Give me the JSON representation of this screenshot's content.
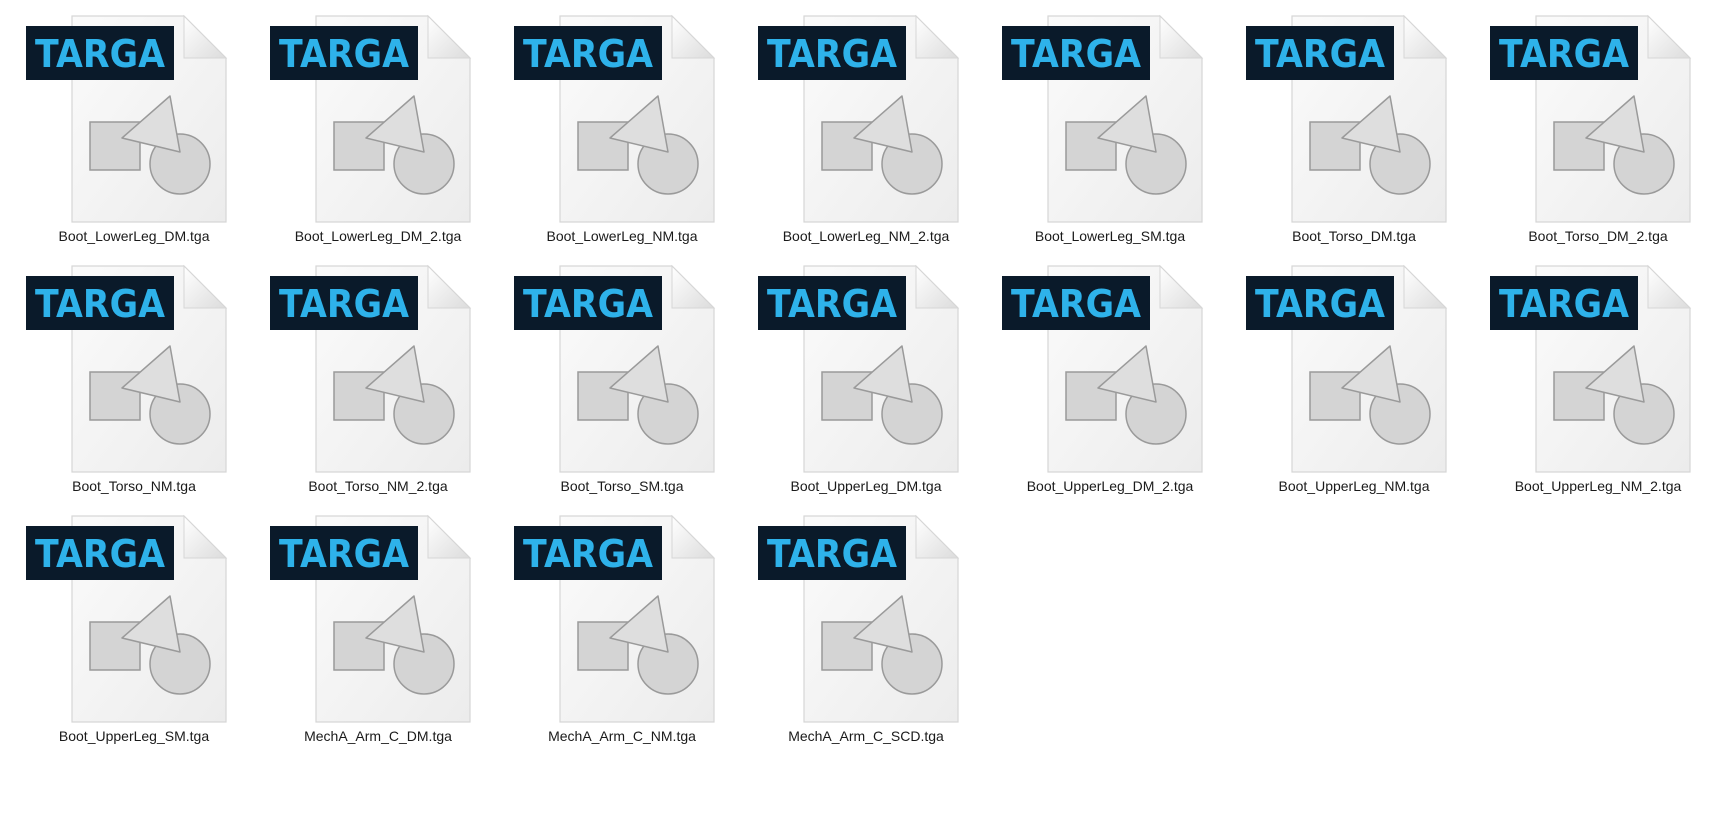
{
  "icon_badge_text": "TARGA",
  "colors": {
    "badge_background": "#0a1a2a",
    "badge_text": "#2eb2ea",
    "page_background": "#f4f4f4",
    "shape_fill": "#d4d4d4",
    "shape_stroke": "#9a9a9a",
    "label_text": "#1a1a1a"
  },
  "files": [
    {
      "name": "Boot_LowerLeg_DM.tga"
    },
    {
      "name": "Boot_LowerLeg_DM_2.tga"
    },
    {
      "name": "Boot_LowerLeg_NM.tga"
    },
    {
      "name": "Boot_LowerLeg_NM_2.tga"
    },
    {
      "name": "Boot_LowerLeg_SM.tga"
    },
    {
      "name": "Boot_Torso_DM.tga"
    },
    {
      "name": "Boot_Torso_DM_2.tga"
    },
    {
      "name": "Boot_Torso_NM.tga"
    },
    {
      "name": "Boot_Torso_NM_2.tga"
    },
    {
      "name": "Boot_Torso_SM.tga"
    },
    {
      "name": "Boot_UpperLeg_DM.tga"
    },
    {
      "name": "Boot_UpperLeg_DM_2.tga"
    },
    {
      "name": "Boot_UpperLeg_NM.tga"
    },
    {
      "name": "Boot_UpperLeg_NM_2.tga"
    },
    {
      "name": "Boot_UpperLeg_SM.tga"
    },
    {
      "name": "MechA_Arm_C_DM.tga"
    },
    {
      "name": "MechA_Arm_C_NM.tga"
    },
    {
      "name": "MechA_Arm_C_SCD.tga"
    }
  ]
}
